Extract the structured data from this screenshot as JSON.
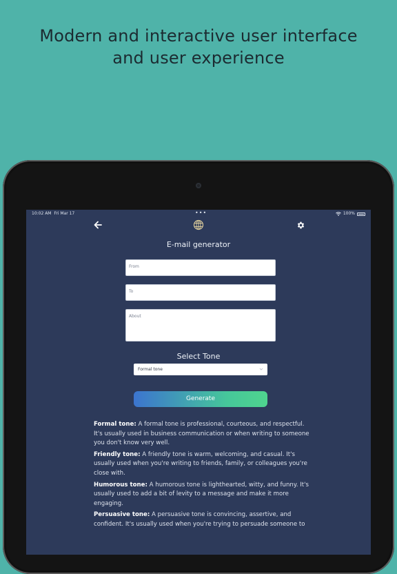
{
  "headline": {
    "line1": "Modern and interactive user interface",
    "line2": "and user experience"
  },
  "status_bar": {
    "time": "10:02 AM",
    "date": "Fri Mar 17",
    "center_dots": "•••",
    "battery": "100%"
  },
  "nav": {
    "back_icon": "arrow-left-icon",
    "center_icon": "globe-icon",
    "settings_icon": "gear-icon"
  },
  "screen_title": "E-mail generator",
  "form": {
    "from_placeholder": "From",
    "to_placeholder": "To",
    "about_placeholder": "About"
  },
  "tone": {
    "label": "Select Tone",
    "selected": "Formal tone"
  },
  "generate_label": "Generate",
  "descriptions": [
    {
      "title": "Formal tone:",
      "text": " A formal tone is professional, courteous, and respectful. It's usually used in business communication or when writing to someone you don't know very well."
    },
    {
      "title": "Friendly tone:",
      "text": " A friendly tone is warm, welcoming, and casual. It's usually used when you're writing to friends, family, or colleagues you're close with."
    },
    {
      "title": "Humorous tone:",
      "text": " A humorous tone is lighthearted, witty, and funny. It's usually used to add a bit of levity to a message and make it more engaging."
    },
    {
      "title": "Persuasive tone:",
      "text": " A persuasive tone is convincing, assertive, and confident. It's usually used when you're trying to persuade someone to"
    }
  ],
  "colors": {
    "background": "#4fb3a9",
    "screen": "#2d3a5a",
    "button_gradient_start": "#3c74cf",
    "button_gradient_end": "#4fd48e"
  }
}
